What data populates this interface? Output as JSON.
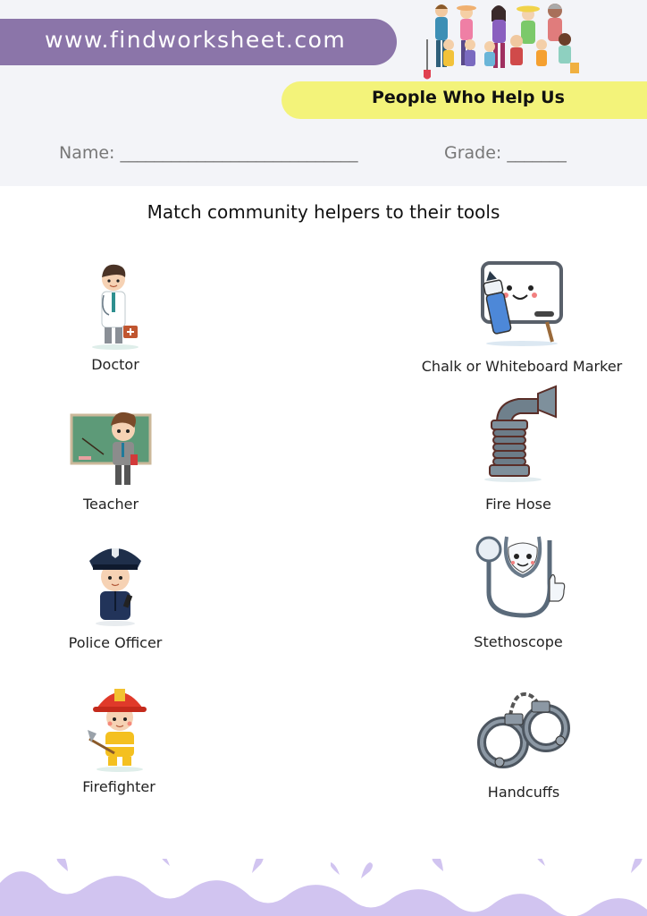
{
  "header": {
    "site": "www.findworksheet.com",
    "title": "People Who Help Us",
    "name_label": "Name: ____________________________",
    "grade_label": "Grade: _______"
  },
  "instructions": "Match community helpers to their tools",
  "helpers": [
    {
      "label": "Doctor",
      "icon": "doctor-icon"
    },
    {
      "label": "Teacher",
      "icon": "teacher-icon"
    },
    {
      "label": "Police Officer",
      "icon": "police-officer-icon"
    },
    {
      "label": "Firefighter",
      "icon": "firefighter-icon"
    }
  ],
  "tools": [
    {
      "label": "Chalk or Whiteboard Marker",
      "icon": "whiteboard-marker-icon"
    },
    {
      "label": "Fire Hose",
      "icon": "fire-hose-icon"
    },
    {
      "label": "Stethoscope",
      "icon": "stethoscope-icon"
    },
    {
      "label": "Handcuffs",
      "icon": "handcuffs-icon"
    }
  ],
  "colors": {
    "header_bg": "#f3f4f8",
    "site_pill": "#8b75a9",
    "title_pill": "#f3f37a",
    "footer_wave": "#d1c4f0"
  }
}
